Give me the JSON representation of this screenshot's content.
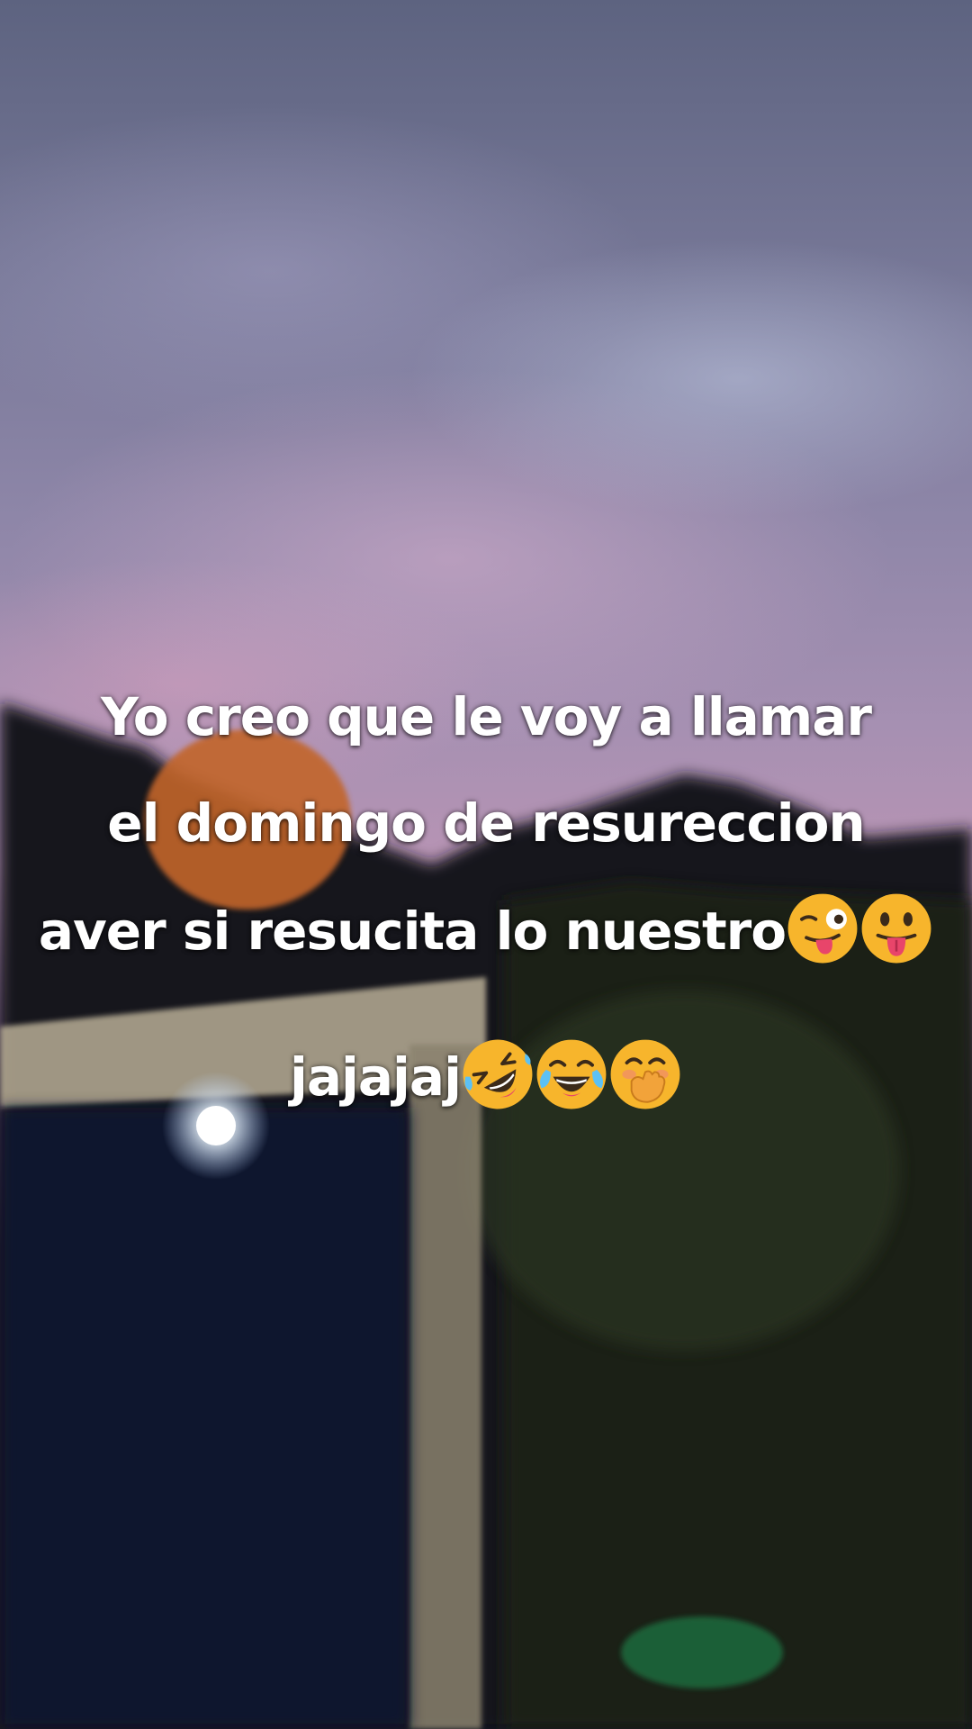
{
  "caption": {
    "line1": "Yo creo que le voy a llamar",
    "line2": "el domingo de resureccion",
    "line3": "aver si resucita lo nuestro",
    "line4": "jajajaj"
  },
  "emojis": {
    "line3": [
      "winking-face-with-tongue",
      "face-with-tongue"
    ],
    "line4": [
      "rolling-on-floor-laughing",
      "face-with-tears-of-joy",
      "face-with-hand-over-mouth"
    ]
  },
  "colors": {
    "caption_text": "#ffffff",
    "emoji_yellow": "#f7b52c"
  }
}
